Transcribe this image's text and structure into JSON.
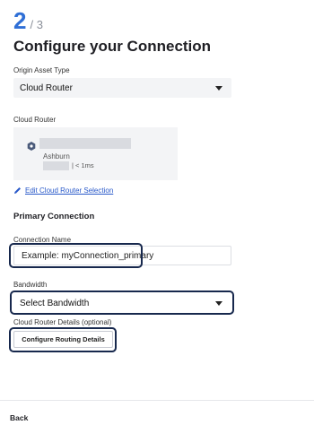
{
  "stepper": {
    "current": "2",
    "total": "/ 3"
  },
  "title": "Configure your Connection",
  "origin_asset_type": {
    "label": "Origin Asset Type",
    "value": "Cloud Router"
  },
  "cloud_router": {
    "label": "Cloud Router",
    "location": "Ashburn",
    "latency": "| < 1ms",
    "edit_link": "Edit Cloud Router Selection"
  },
  "primary_connection": {
    "section_title": "Primary Connection",
    "connection_name": {
      "label": "Connection Name",
      "placeholder": "Example: myConnection_primary"
    },
    "bandwidth": {
      "label": "Bandwidth",
      "value": "Select Bandwidth"
    },
    "cloud_router_details": {
      "label": "Cloud Router Details (optional)",
      "button": "Configure Routing Details"
    }
  },
  "footer": {
    "back": "Back"
  },
  "colors": {
    "accent": "#2f6fd6",
    "link": "#2858c9",
    "focus_ring": "#17284d"
  },
  "icons": {
    "router": "cloud-router-hex-icon",
    "edit": "pencil-icon",
    "dropdown": "chevron-down-icon"
  }
}
